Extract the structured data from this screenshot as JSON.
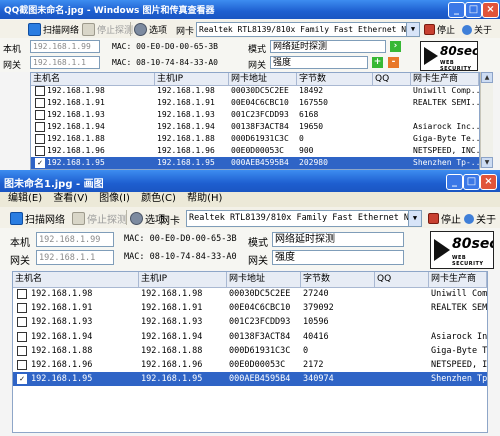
{
  "windows": [
    {
      "title": "QQ截图未命名.jpg - Windows 图片和传真查看器",
      "toolbar": {
        "scan_label": "扫描网络",
        "probe_label": "停止探测",
        "options_label": "选项",
        "nic_label": "网卡",
        "nic_value": "Realtek RTL8139/810x Family Fast Ethernet NI",
        "stop_label": "停止",
        "about_label": "关于"
      },
      "info": {
        "local_label": "本机",
        "local_ip": "192.168.1.99",
        "gateway_label": "网关",
        "gateway_ip": "192.168.1.1",
        "local_mac": "MAC: 00-E0-D0-00-65-3B",
        "gateway_mac": "MAC: 08-10-74-84-33-A0",
        "mode_label": "模式",
        "mode_value": "网络延时探测",
        "strength_label": "网关",
        "strength_value": "强度"
      },
      "columns": [
        "主机名",
        "主机IP",
        "网卡地址",
        "字节数",
        "QQ",
        "网卡生产商"
      ],
      "rows": [
        {
          "name": "192.168.1.98",
          "ip": "192.168.1.98",
          "mac": "00030DC5C2EE",
          "bytes": "18492",
          "qq": "",
          "vendor": "Uniwill Comp...",
          "checked": false,
          "selected": false
        },
        {
          "name": "192.168.1.91",
          "ip": "192.168.1.91",
          "mac": "00E04C6CBC10",
          "bytes": "167550",
          "qq": "",
          "vendor": "REALTEK SEMI...",
          "checked": false,
          "selected": false
        },
        {
          "name": "192.168.1.93",
          "ip": "192.168.1.93",
          "mac": "001C23FCDD93",
          "bytes": "6168",
          "qq": "",
          "vendor": "",
          "checked": false,
          "selected": false
        },
        {
          "name": "192.168.1.94",
          "ip": "192.168.1.94",
          "mac": "00138F3ACT84",
          "bytes": "19650",
          "qq": "",
          "vendor": "Asiarock Inc...",
          "checked": false,
          "selected": false
        },
        {
          "name": "192.168.1.88",
          "ip": "192.168.1.88",
          "mac": "000D61931C3C",
          "bytes": "0",
          "qq": "",
          "vendor": "Giga-Byte Te...",
          "checked": false,
          "selected": false
        },
        {
          "name": "192.168.1.96",
          "ip": "192.168.1.96",
          "mac": "00E0D00053C",
          "bytes": "900",
          "qq": "",
          "vendor": "NETSPEED, INC...",
          "checked": false,
          "selected": false
        },
        {
          "name": "192.168.1.95",
          "ip": "192.168.1.95",
          "mac": "000AEB4595B4",
          "bytes": "202980",
          "qq": "",
          "vendor": "Shenzhen Tp-...",
          "checked": true,
          "selected": true
        }
      ]
    },
    {
      "title": "图未命名1.jpg - 画图",
      "menu": [
        "编辑(E)",
        "查看(V)",
        "图像(I)",
        "颜色(C)",
        "帮助(H)"
      ],
      "toolbar": {
        "scan_label": "扫描网络",
        "probe_label": "停止探测",
        "options_label": "选项",
        "nic_label": "网卡",
        "nic_value": "Realtek RTL8139/810x Family Fast Ethernet NI",
        "stop_label": "停止",
        "about_label": "关于"
      },
      "info": {
        "local_label": "本机",
        "local_ip": "192.168.1.99",
        "gateway_label": "网关",
        "gateway_ip": "192.168.1.1",
        "local_mac": "MAC: 00-E0-D0-00-65-3B",
        "gateway_mac": "MAC: 08-10-74-84-33-A0",
        "mode_label": "模式",
        "mode_value": "网络延时探测",
        "strength_label": "网关",
        "strength_value": "强度"
      },
      "columns": [
        "主机名",
        "主机IP",
        "网卡地址",
        "字节数",
        "QQ",
        "网卡生产商"
      ],
      "rows": [
        {
          "name": "192.168.1.98",
          "ip": "192.168.1.98",
          "mac": "00030DC5C2EE",
          "bytes": "27240",
          "qq": "",
          "vendor": "Uniwill Comp...",
          "checked": false,
          "selected": false
        },
        {
          "name": "192.168.1.91",
          "ip": "192.168.1.91",
          "mac": "00E04C6CBC10",
          "bytes": "379092",
          "qq": "",
          "vendor": "REALTEK SEMI...",
          "checked": false,
          "selected": false
        },
        {
          "name": "192.168.1.93",
          "ip": "192.168.1.93",
          "mac": "001C23FCDD93",
          "bytes": "10596",
          "qq": "",
          "vendor": "",
          "checked": false,
          "selected": false
        },
        {
          "name": "192.168.1.94",
          "ip": "192.168.1.94",
          "mac": "00138F3ACT84",
          "bytes": "40416",
          "qq": "",
          "vendor": "Asiarock Inc...",
          "checked": false,
          "selected": false
        },
        {
          "name": "192.168.1.88",
          "ip": "192.168.1.88",
          "mac": "000D61931C3C",
          "bytes": "0",
          "qq": "",
          "vendor": "Giga-Byte Te...",
          "checked": false,
          "selected": false
        },
        {
          "name": "192.168.1.96",
          "ip": "192.168.1.96",
          "mac": "00E0D00053C",
          "bytes": "2172",
          "qq": "",
          "vendor": "NETSPEED, INC...",
          "checked": false,
          "selected": false
        },
        {
          "name": "192.168.1.95",
          "ip": "192.168.1.95",
          "mac": "000AEB4595B4",
          "bytes": "340974",
          "qq": "",
          "vendor": "Shenzhen Tp-...",
          "checked": true,
          "selected": true
        }
      ]
    }
  ],
  "logo": {
    "big": "80sec",
    "small": "WEB SECURITY"
  },
  "colors": {
    "titlebar": "#1e5fd0",
    "selection": "#2f64c6",
    "accent_green": "#37b835",
    "accent_orange": "#e8782a"
  }
}
